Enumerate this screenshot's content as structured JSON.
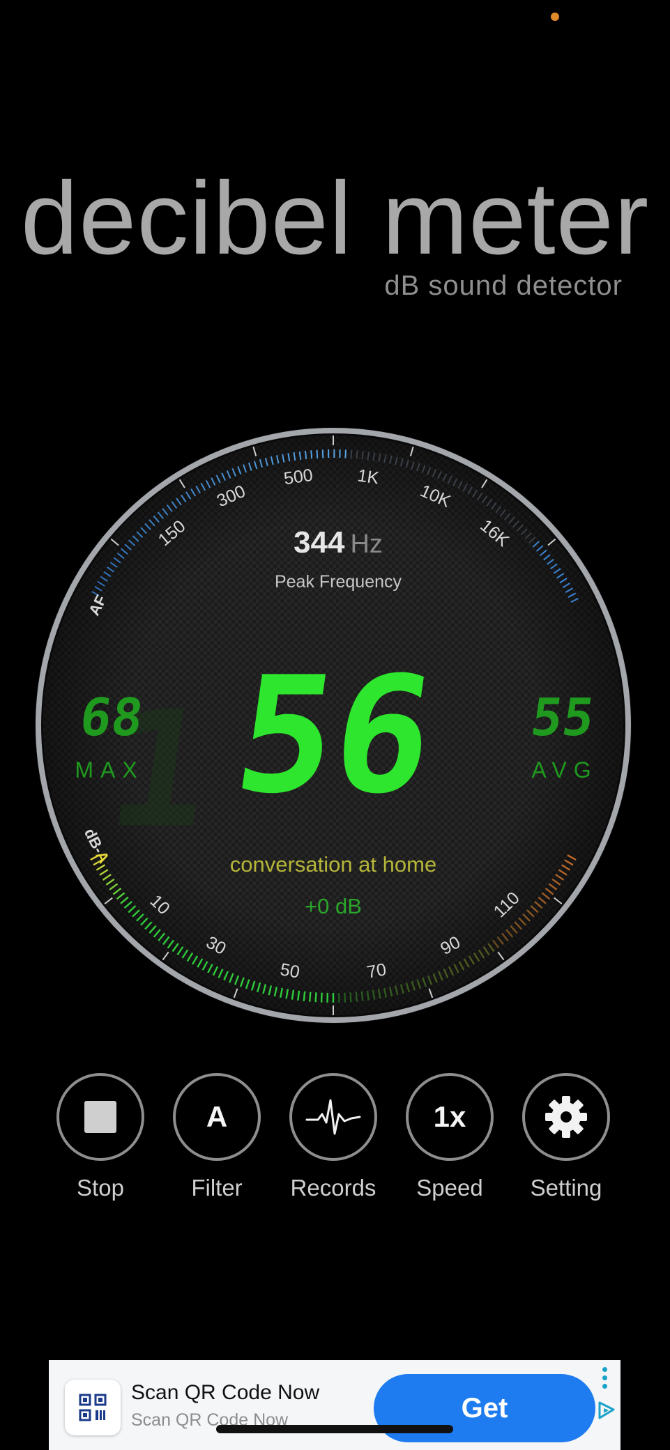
{
  "header": {
    "title": "decibel meter",
    "subtitle": "dB sound detector"
  },
  "gauge": {
    "frequency_value": "344",
    "frequency_unit": "Hz",
    "frequency_label": "Peak Frequency",
    "current_db": "56",
    "max_value": "68",
    "max_label": "MAX",
    "avg_value": "55",
    "avg_label": "AVG",
    "description": "conversation at home",
    "offset": "+0 dB",
    "top_scale_prefix": "AF",
    "top_scale_labels": [
      "150",
      "300",
      "500",
      "1K",
      "10K",
      "16K"
    ],
    "bottom_scale_prefix_1": "dB-",
    "bottom_scale_prefix_2": "A",
    "bottom_scale_labels": [
      "10",
      "30",
      "50",
      "70",
      "90",
      "110"
    ],
    "level_fraction": 0.5
  },
  "controls": [
    {
      "label": "Stop",
      "icon": "stop-icon"
    },
    {
      "label": "Filter",
      "icon": "filter-icon",
      "text": "A"
    },
    {
      "label": "Records",
      "icon": "heartbeat-icon"
    },
    {
      "label": "Speed",
      "icon": "speed-icon",
      "text": "1x"
    },
    {
      "label": "Setting",
      "icon": "gear-icon"
    }
  ],
  "ad": {
    "title": "Scan QR Code Now",
    "subtitle": "Scan QR Code Now",
    "cta": "Get"
  },
  "colors": {
    "digit_green": "#2ee62e",
    "dim_green": "#1f9a1f",
    "description_yellow": "#b5b53a",
    "ring_grey": "#a3a6ab",
    "freq_blue": "#3a84d6"
  }
}
